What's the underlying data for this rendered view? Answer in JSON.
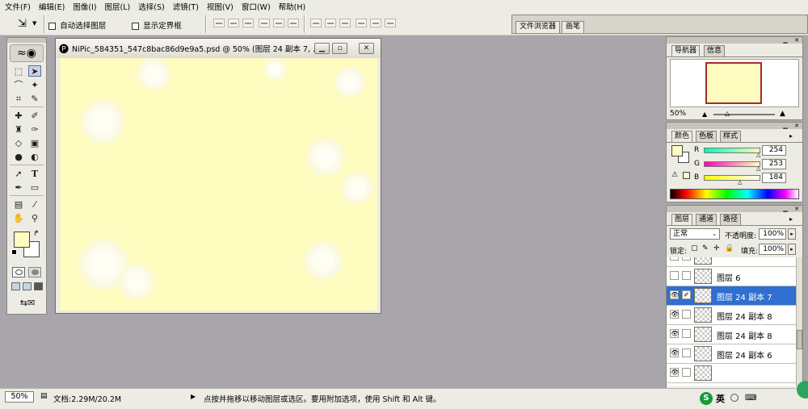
{
  "menu": [
    "文件(F)",
    "编辑(E)",
    "图像(I)",
    "图层(L)",
    "选择(S)",
    "滤镜(T)",
    "视图(V)",
    "窗口(W)",
    "帮助(H)"
  ],
  "options": {
    "auto_select_label": "自动选择图层",
    "show_bounds_label": "显示定界框",
    "palette_well_tabs": [
      "文件浏览器",
      "画笔"
    ]
  },
  "document": {
    "title": "NiPic_584351_547c8bac86d9e9a5.psd @ 50% (图层 24 副本 7, ...",
    "canvas_color": "#fefcbf"
  },
  "navigator": {
    "tabs": [
      "导航器",
      "信息"
    ],
    "zoom": "50%"
  },
  "color_panel": {
    "tabs": [
      "颜色",
      "色板",
      "样式"
    ],
    "r_label": "R",
    "g_label": "G",
    "b_label": "B",
    "r": "254",
    "g": "253",
    "b": "184"
  },
  "layers_panel": {
    "tabs": [
      "图层",
      "通道",
      "路径"
    ],
    "blend_mode": "正常",
    "opacity_label": "不透明度:",
    "opacity": "100%",
    "lock_label": "锁定:",
    "fill_label": "填充:",
    "fill": "100%",
    "layers": [
      {
        "name": "图层 6",
        "visible": false,
        "selected": false
      },
      {
        "name": "图层 24 副本 7",
        "visible": true,
        "selected": true
      },
      {
        "name": "图层 24 副本 8",
        "visible": true,
        "selected": false
      },
      {
        "name": "图层 24 副本 8",
        "visible": true,
        "selected": false
      },
      {
        "name": "图层 24 副本 6",
        "visible": true,
        "selected": false
      }
    ]
  },
  "status": {
    "zoom": "50%",
    "doc_size": "文档:2.29M/20.2M",
    "hint": "点按并拖移以移动图层或选区。要用附加选项，使用 Shift 和 Alt 键。"
  },
  "taskbar": {
    "ime_label": "英"
  },
  "colors": {
    "foreground": "#fefcbf",
    "background": "#ffffff",
    "selection": "#2f6fd0"
  }
}
